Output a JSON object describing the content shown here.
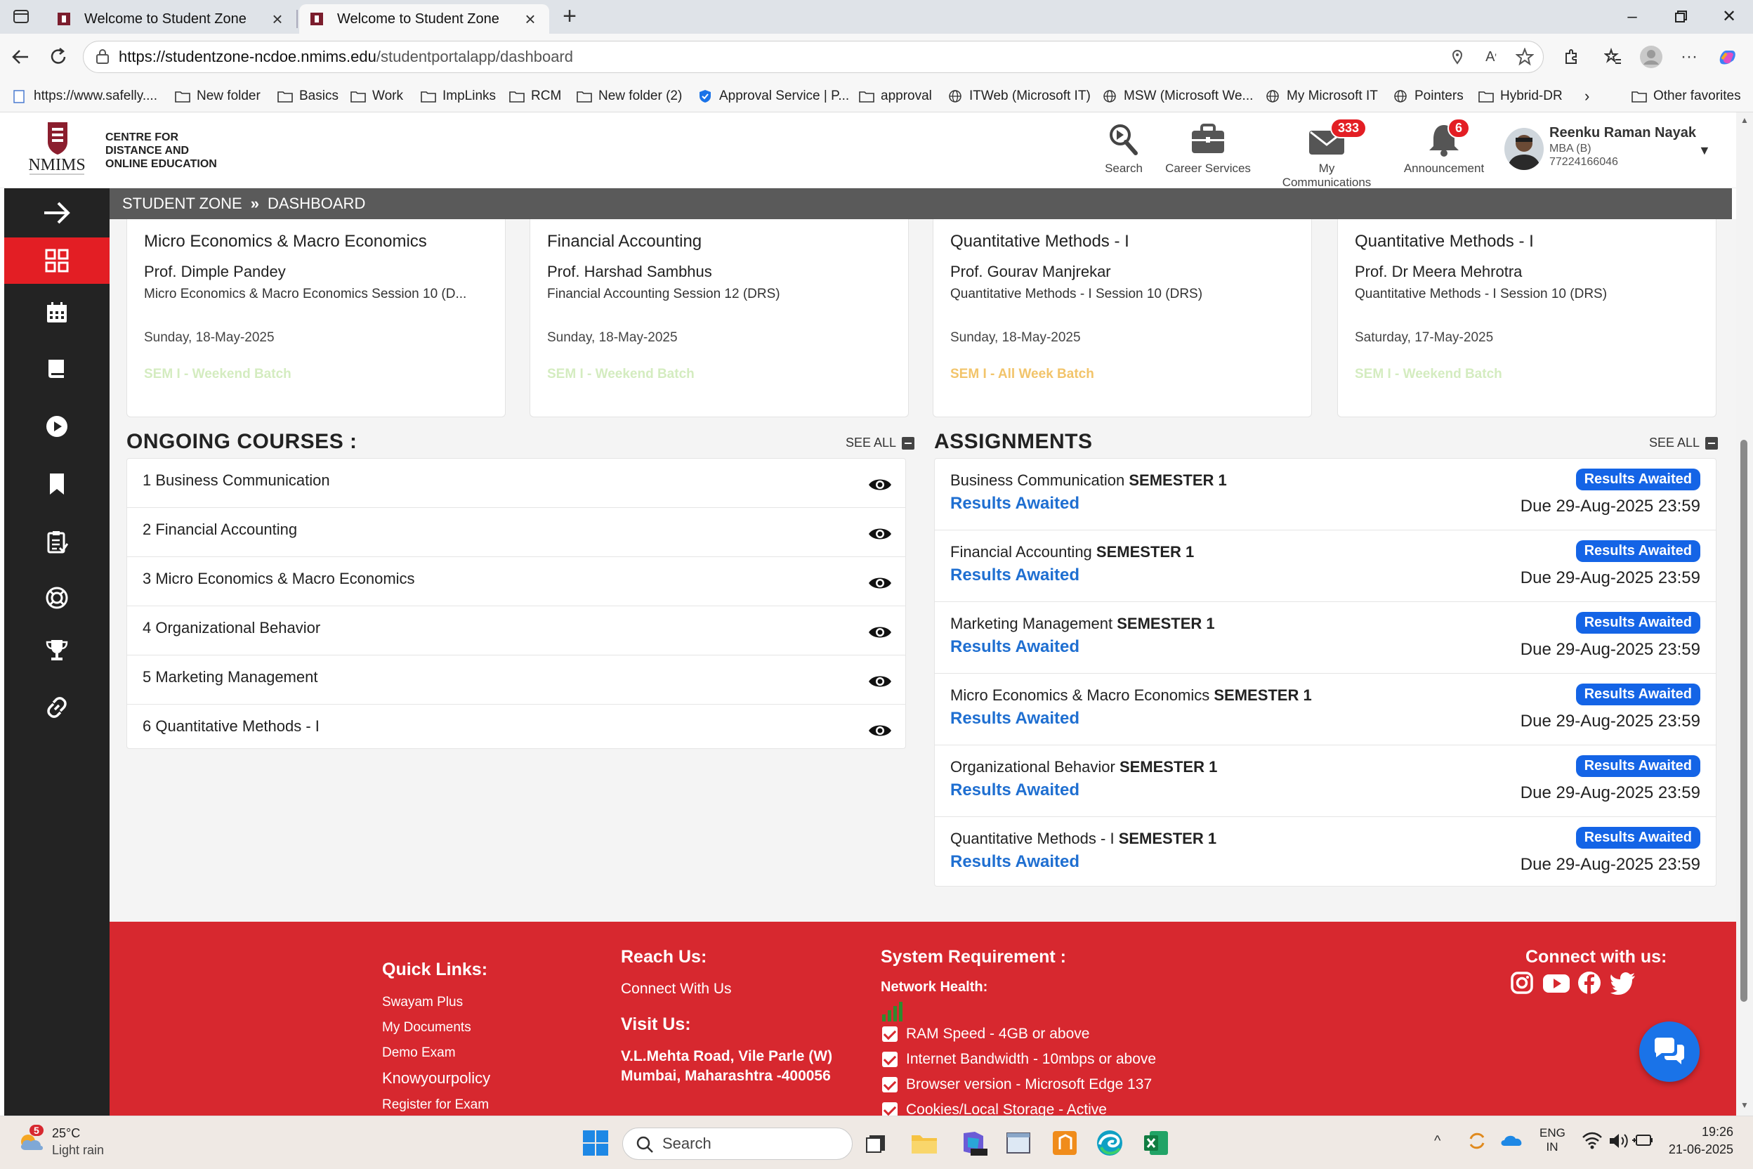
{
  "browser": {
    "tabs": [
      {
        "title": "Welcome to Student Zone",
        "active": false
      },
      {
        "title": "Welcome to Student Zone",
        "active": true
      }
    ],
    "url_host": "https://studentzone-ncdoe.nmims.edu",
    "url_path": "/studentportalapp/dashboard",
    "bookmarks": [
      "https://www.safelly....",
      "New folder",
      "Basics",
      "Work",
      "ImpLinks",
      "RCM",
      "New folder (2)",
      "Approval Service | P...",
      "approval",
      "ITWeb (Microsoft IT)",
      "MSW (Microsoft We...",
      "My Microsoft IT",
      "Pointers",
      "Hybrid-DR"
    ],
    "other_favorites": "Other favorites"
  },
  "header": {
    "logo_text": "NMIMS",
    "org_line1": "CENTRE FOR",
    "org_line2": "DISTANCE AND",
    "org_line3": "ONLINE EDUCATION",
    "search_label": "Search",
    "career_label": "Career Services",
    "comm_label": "My Communications",
    "comm_count": "333",
    "announce_label": "Announcement",
    "announce_count": "6",
    "user_name": "Reenku Raman Nayak",
    "user_program": "MBA (B)",
    "user_id": "77224166046"
  },
  "breadcrumb": {
    "root": "STUDENT ZONE",
    "current": "DASHBOARD"
  },
  "sessions": [
    {
      "title": "Micro Economics & Macro Economics",
      "prof": "Prof. Dimple Pandey",
      "session": "Micro Economics & Macro Economics Session 10 (D...",
      "date": "Sunday, 18-May-2025",
      "batch": "SEM I - Weekend Batch",
      "batch_color": "#d4ecc0"
    },
    {
      "title": "Financial Accounting",
      "prof": "Prof. Harshad Sambhus",
      "session": "Financial Accounting Session 12 (DRS)",
      "date": "Sunday, 18-May-2025",
      "batch": "SEM I - Weekend Batch",
      "batch_color": "#d4ecc0"
    },
    {
      "title": "Quantitative Methods - I",
      "prof": "Prof. Gourav Manjrekar",
      "session": "Quantitative Methods - I Session 10 (DRS)",
      "date": "Sunday, 18-May-2025",
      "batch": "SEM I - All Week Batch",
      "batch_color": "#f2c46a"
    },
    {
      "title": "Quantitative Methods - I",
      "prof": "Prof. Dr Meera Mehrotra",
      "session": "Quantitative Methods - I Session 10 (DRS)",
      "date": "Saturday, 17-May-2025",
      "batch": "SEM I - Weekend Batch",
      "batch_color": "#d4ecc0"
    }
  ],
  "courses": {
    "heading": "ONGOING COURSES :",
    "see_all": "SEE ALL",
    "items": [
      "1 Business Communication",
      "2 Financial Accounting",
      "3 Micro Economics & Macro Economics",
      "4 Organizational Behavior",
      "5 Marketing Management",
      "6 Quantitative Methods - I"
    ]
  },
  "assignments": {
    "heading": "ASSIGNMENTS",
    "see_all": "SEE ALL",
    "items": [
      {
        "name": "Business Communication",
        "sem": "SEMESTER 1",
        "status": "Results Awaited",
        "badge": "Results Awaited",
        "due": "Due 29-Aug-2025 23:59"
      },
      {
        "name": "Financial Accounting",
        "sem": "SEMESTER 1",
        "status": "Results Awaited",
        "badge": "Results Awaited",
        "due": "Due 29-Aug-2025 23:59"
      },
      {
        "name": "Marketing Management",
        "sem": "SEMESTER 1",
        "status": "Results Awaited",
        "badge": "Results Awaited",
        "due": "Due 29-Aug-2025 23:59"
      },
      {
        "name": "Micro Economics & Macro Economics",
        "sem": "SEMESTER 1",
        "status": "Results Awaited",
        "badge": "Results Awaited",
        "due": "Due 29-Aug-2025 23:59"
      },
      {
        "name": "Organizational Behavior",
        "sem": "SEMESTER 1",
        "status": "Results Awaited",
        "badge": "Results Awaited",
        "due": "Due 29-Aug-2025 23:59"
      },
      {
        "name": "Quantitative Methods - I",
        "sem": "SEMESTER 1",
        "status": "Results Awaited",
        "badge": "Results Awaited",
        "due": "Due 29-Aug-2025 23:59"
      }
    ]
  },
  "footer": {
    "quick_links_heading": "Quick Links:",
    "quick_links": [
      "Swayam Plus",
      "My Documents",
      "Demo Exam",
      "Knowyourpolicy",
      "Register for Exam"
    ],
    "reach_heading": "Reach Us:",
    "reach_link": "Connect With Us",
    "visit_heading": "Visit Us:",
    "address_line1": "V.L.Mehta Road, Vile Parle (W)",
    "address_line2": "Mumbai, Maharashtra -400056",
    "sysreq_heading": "System Requirement :",
    "network_label": "Network Health:",
    "requirements": [
      "RAM Speed - 4GB or above",
      "Internet Bandwidth - 10mbps or above",
      "Browser version - Microsoft Edge 137",
      "Cookies/Local Storage - Active"
    ],
    "connect_heading": "Connect with us:"
  },
  "taskbar": {
    "weather_badge": "5",
    "temp": "25°C",
    "weather": "Light rain",
    "search": "Search",
    "lang1": "ENG",
    "lang2": "IN",
    "time": "19:26",
    "date": "21-06-2025"
  },
  "colors": {
    "brand_red": "#e31e24",
    "footer_red": "#d7282f",
    "badge_blue": "#1464e6",
    "link_blue": "#1f6fd1"
  }
}
